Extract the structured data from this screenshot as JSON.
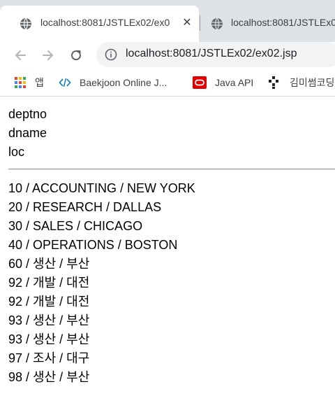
{
  "tabs": [
    {
      "title": "localhost:8081/JSTLEx02/ex0",
      "active": true,
      "close": "✕"
    },
    {
      "title": "localhost:8081/JSTLEx0",
      "active": false
    }
  ],
  "toolbar": {
    "url": "localhost:8081/JSTLEx02/ex02.jsp"
  },
  "bookmarks": [
    {
      "label": "앱",
      "icon": "apps-grid-icon"
    },
    {
      "label": "Baekjoon Online J...",
      "icon": "code-brackets-icon"
    },
    {
      "label": "Java API",
      "icon": "oracle-icon"
    },
    {
      "label": "김미썸코딩",
      "icon": "bookmark-icon"
    }
  ],
  "page": {
    "headers": [
      "deptno",
      "dname",
      "loc"
    ],
    "rows": [
      "10 / ACCOUNTING / NEW YORK",
      "20 / RESEARCH / DALLAS",
      "30 / SALES / CHICAGO",
      "40 / OPERATIONS / BOSTON",
      "60 / 생산 / 부산",
      "92 / 개발 / 대전",
      "92 / 개발 / 대전",
      "93 / 생산 / 부산",
      "93 / 생산 / 부산",
      "97 / 조사 / 대구",
      "98 / 생산 / 부산"
    ]
  },
  "colors": {
    "tabstrip": "#dee1e6",
    "omnibox": "#f1f3f4",
    "oracle_red": "#e00000"
  }
}
